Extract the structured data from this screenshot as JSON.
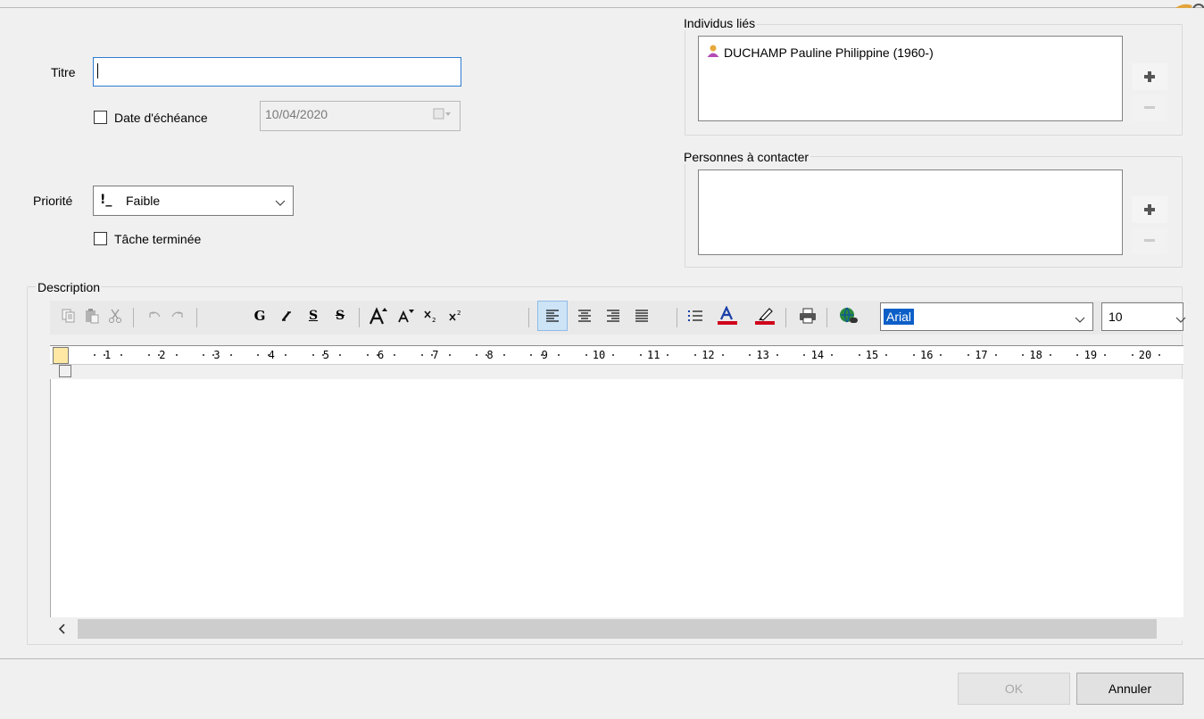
{
  "form": {
    "title_label": "Titre",
    "title_value": "",
    "due_date_label": "Date d'échéance",
    "due_date_checked": false,
    "due_date_value": "10/04/2020",
    "priority_label": "Priorité",
    "priority_prefix": "!_",
    "priority_value": "Faible",
    "task_done_label": "Tâche terminée",
    "task_done_checked": false
  },
  "linked": {
    "title": "Individus liés",
    "items": [
      {
        "label": "DUCHAMP Pauline Philippine (1960-)",
        "icon": "person-icon"
      }
    ]
  },
  "contacts": {
    "title": "Personnes à contacter",
    "items": []
  },
  "description": {
    "title": "Description",
    "font_value": "Arial",
    "size_value": "10",
    "ruler_numbers": [
      "1",
      "2",
      "3",
      "4",
      "5",
      "6",
      "7",
      "8",
      "9",
      "10",
      "11",
      "12",
      "13",
      "14",
      "15",
      "16",
      "17",
      "18",
      "19",
      "20"
    ],
    "toolbar": [
      "copy-icon",
      "paste-icon",
      "cut-icon",
      "undo-icon",
      "redo-icon",
      "bold-icon",
      "italic-icon",
      "underline-icon",
      "strikethrough-icon",
      "increase-font-icon",
      "decrease-font-icon",
      "subscript-icon",
      "superscript-icon",
      "align-left-icon",
      "align-center-icon",
      "align-right-icon",
      "justify-icon",
      "bullet-list-icon",
      "font-color-icon",
      "highlight-icon",
      "print-icon",
      "insert-link-icon"
    ],
    "bold_glyph": "G",
    "italic_glyph": "I",
    "underline_glyph": "S",
    "strike_glyph": "S",
    "sub_glyph": "x",
    "sup_glyph": "x",
    "font_color_glyph": "A"
  },
  "buttons": {
    "ok": "OK",
    "cancel": "Annuler"
  },
  "colors": {
    "accent": "#0c5fc7",
    "focus_border": "#2e7bd2",
    "person_icon": "#e7a93b",
    "font_color_bar": "#d0021b"
  }
}
